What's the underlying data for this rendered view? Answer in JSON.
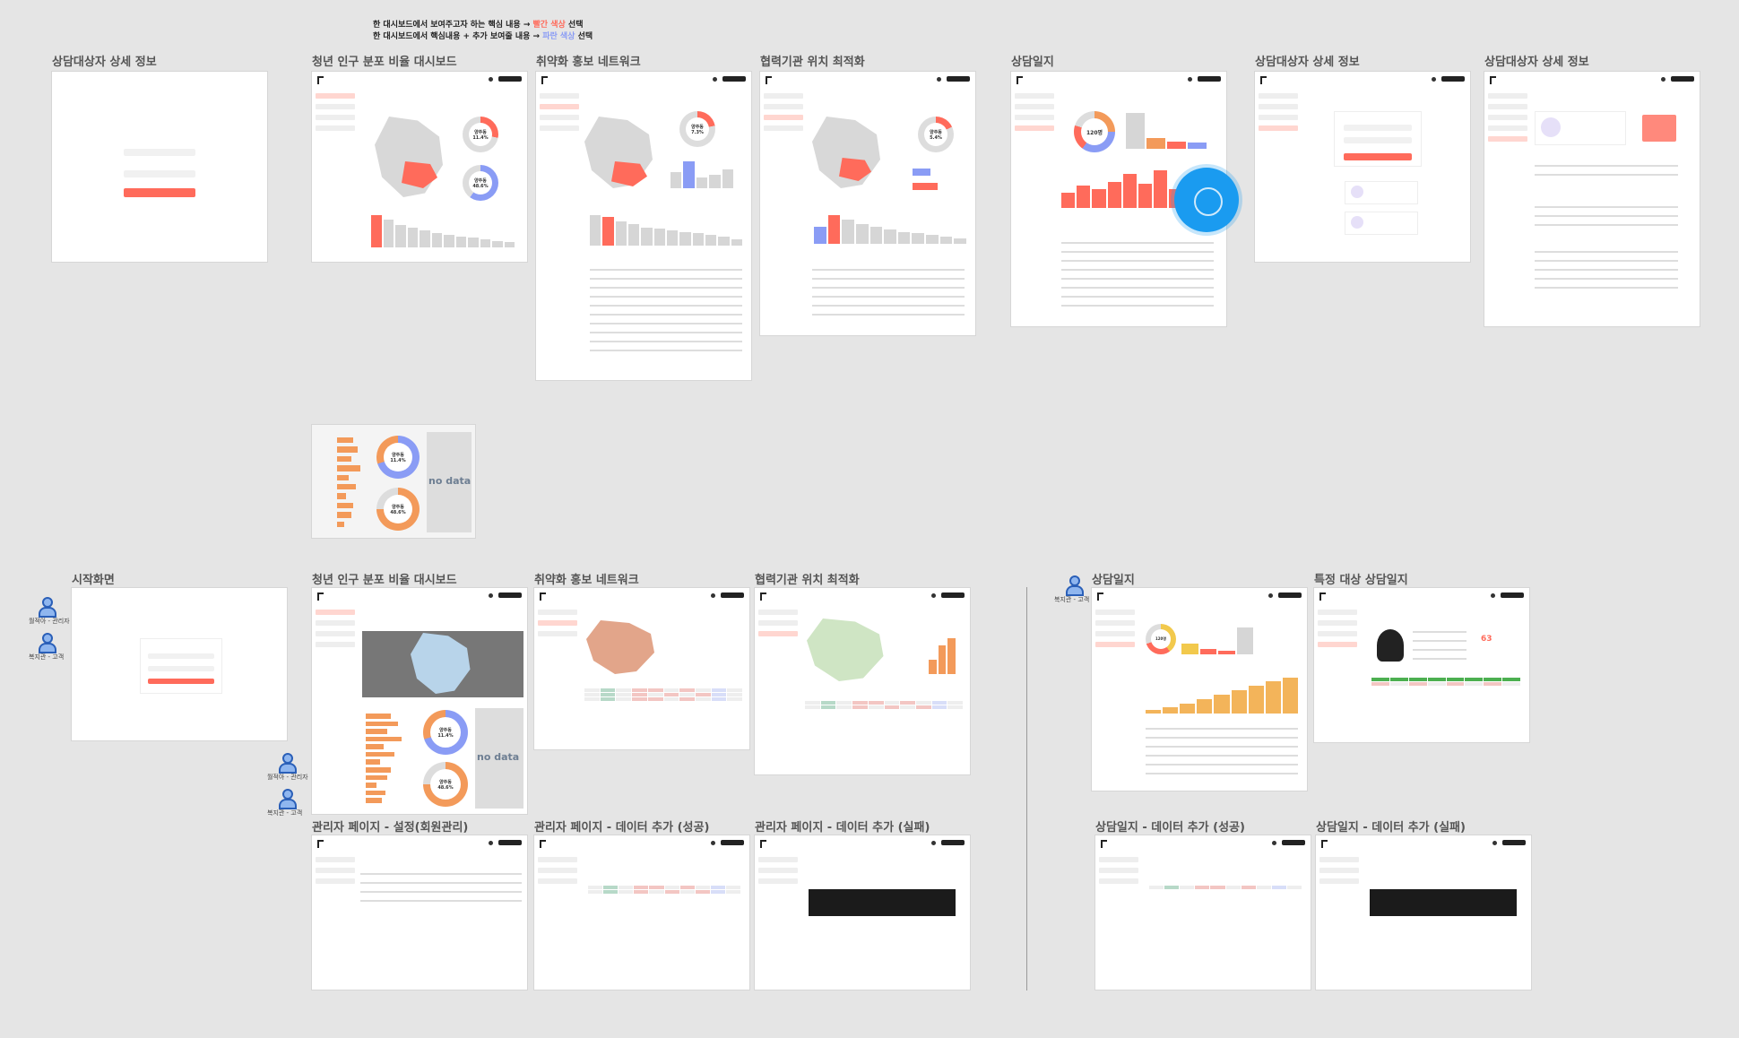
{
  "note": {
    "line1_prefix": "한 대시보드에서 보여주고자 하는 핵심 내용 → ",
    "line1_red": "빨간 색상",
    "line1_suffix": " 선택",
    "line2_prefix": "한 대시보드에서 핵심내용 + 추가 보여줄 내용 → ",
    "line2_blue": "파란 색상",
    "line2_suffix": " 선택"
  },
  "frames": {
    "f1": "상담대상자 상세 정보",
    "f2": "청년 인구 분포 비율 대시보드",
    "f3": "취약화 홍보 네트워크",
    "f4": "협력기관 위치 최적화",
    "f5": "상담일지",
    "f6": "상담대상자 상세 정보",
    "f7": "상담대상자 상세 정보",
    "g1": "시작화면",
    "g2": "청년 인구 분포 비율 대시보드",
    "g3": "취약화 홍보 네트워크",
    "g4": "협력기관 위치 최적화",
    "g5": "상담일지",
    "g6": "특정 대상 상담일지",
    "h1": "관리자 페이지 - 설정(회원관리)",
    "h2": "관리자 페이지 - 데이터 추가 (성공)",
    "h3": "관리자 페이지 - 데이터 추가 (실패)",
    "h4": "상담일지 - 데이터 추가 (성공)",
    "h5": "상담일지 - 데이터 추가 (실패)"
  },
  "donut": {
    "a": "양주동\n11.4%",
    "b": "양주동\n48.6%",
    "c": "양주동\n7.3%",
    "d": "양주동\n5.4%",
    "e": "120명",
    "nodata": "no data"
  },
  "persons": {
    "p1": "월적아 - 관리자",
    "p2": "복지관 - 고객",
    "p3": "월적아 - 관리자",
    "p4": "복지관 - 고객",
    "p5": "복지관 - 고객"
  },
  "colors": {
    "accent": "#ff6b5b",
    "blue": "#8a9cf5",
    "orange": "#f39a5a",
    "fab": "#1a9bf0"
  }
}
